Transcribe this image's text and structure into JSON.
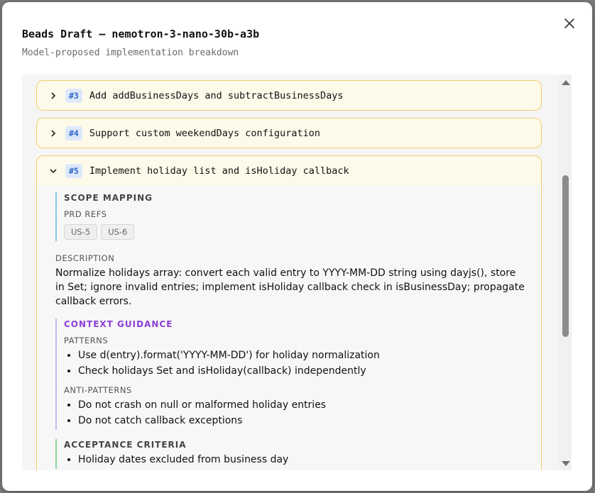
{
  "modal": {
    "title": "Beads Draft — nemotron-3-nano-30b-a3b",
    "subtitle": "Model-proposed implementation breakdown"
  },
  "icons": {
    "close": "close-icon",
    "chevron_right": "chevron-right-icon",
    "chevron_down": "chevron-down-icon"
  },
  "colors": {
    "card_border": "#f0cf6b",
    "badge": "#2e64c9",
    "context": "#8b3fd6",
    "scope_border": "#86c7ec",
    "criteria_border": "#8bd49a"
  },
  "beads": [
    {
      "number": "#3",
      "title": "Add addBusinessDays and subtractBusinessDays",
      "expanded": false
    },
    {
      "number": "#4",
      "title": "Support custom weekendDays configuration",
      "expanded": false
    },
    {
      "number": "#5",
      "title": "Implement holiday list and isHoliday callback",
      "expanded": true,
      "scope_mapping": {
        "heading": "SCOPE MAPPING",
        "prd_refs_label": "PRD REFS",
        "prd_refs": [
          "US-5",
          "US-6"
        ]
      },
      "description_label": "DESCRIPTION",
      "description": "Normalize holidays array: convert each valid entry to YYYY-MM-DD string using dayjs(), store in Set; ignore invalid entries; implement isHoliday callback check in isBusinessDay; propagate callback errors.",
      "context_guidance": {
        "heading": "CONTEXT GUIDANCE",
        "patterns_label": "PATTERNS",
        "patterns": [
          "Use d(entry).format('YYYY-MM-DD') for holiday normalization",
          "Check holidays Set and isHoliday(callback) independently"
        ],
        "anti_patterns_label": "ANTI-PATTERNS",
        "anti_patterns": [
          "Do not crash on null or malformed holiday entries",
          "Do not catch callback exceptions"
        ]
      },
      "acceptance_criteria": {
        "heading": "ACCEPTANCE CRITERIA",
        "items": [
          "Holiday dates excluded from business day"
        ]
      }
    }
  ]
}
